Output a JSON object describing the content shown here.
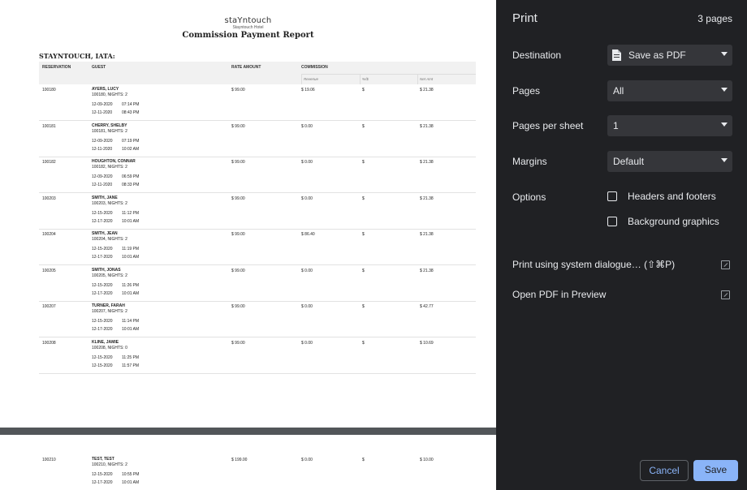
{
  "preview": {
    "logo": "staYntouch",
    "logo_sub": "Stayntouch Hotel",
    "report_title": "Commission Payment Report",
    "hotel_label": "STAYNTOUCH, IATA:",
    "columns": {
      "reservation": "RESERVATION",
      "guest": "GUEST",
      "rate": "RATE AMOUNT",
      "commission": "COMMISSION"
    },
    "subcolumns": {
      "revenue": "Revenue",
      "pct": "%/$",
      "net": "Net Amt"
    },
    "rows": [
      {
        "res": "100180",
        "guest": "AYERS, LUCY",
        "sub": "100180, NIGHTS: 2",
        "d1": "12-09-2020",
        "t1": "07:14 PM",
        "d2": "12-11-2020",
        "t2": "08:43 PM",
        "rate": "$ 99.00",
        "rev": "$ 19.06",
        "pct": "$",
        "net": "$ 21.38"
      },
      {
        "res": "100181",
        "guest": "CHERRY, SHELBY",
        "sub": "100181, NIGHTS: 2",
        "d1": "12-09-2020",
        "t1": "07:19 PM",
        "d2": "12-11-2020",
        "t2": "10:02 AM",
        "rate": "$ 99.00",
        "rev": "$ 0.00",
        "pct": "$",
        "net": "$ 21.38"
      },
      {
        "res": "100182",
        "guest": "HOUGHTON, CONNAR",
        "sub": "100182, NIGHTS: 2",
        "d1": "12-09-2020",
        "t1": "06:59 PM",
        "d2": "12-11-2020",
        "t2": "08:33 PM",
        "rate": "$ 99.00",
        "rev": "$ 0.00",
        "pct": "$",
        "net": "$ 21.38"
      },
      {
        "res": "100203",
        "guest": "SMITH, JANE",
        "sub": "100203, NIGHTS: 2",
        "d1": "12-15-2020",
        "t1": "11:12 PM",
        "d2": "12-17-2020",
        "t2": "10:01 AM",
        "rate": "$ 99.00",
        "rev": "$ 0.00",
        "pct": "$",
        "net": "$ 21.38"
      },
      {
        "res": "100204",
        "guest": "SMITH, JEAN",
        "sub": "100204, NIGHTS: 2",
        "d1": "12-15-2020",
        "t1": "11:19 PM",
        "d2": "12-17-2020",
        "t2": "10:01 AM",
        "rate": "$ 99.00",
        "rev": "$ 86.40",
        "pct": "$",
        "net": "$ 21.38"
      },
      {
        "res": "100205",
        "guest": "SMITH, JONAS",
        "sub": "100205, NIGHTS: 2",
        "d1": "12-15-2020",
        "t1": "11:26 PM",
        "d2": "12-17-2020",
        "t2": "10:01 AM",
        "rate": "$ 99.00",
        "rev": "$ 0.00",
        "pct": "$",
        "net": "$ 21.38"
      },
      {
        "res": "100207",
        "guest": "TURNER, FARAH",
        "sub": "100207, NIGHTS: 2",
        "d1": "12-15-2020",
        "t1": "11:14 PM",
        "d2": "12-17-2020",
        "t2": "10:01 AM",
        "rate": "$ 99.00",
        "rev": "$ 0.00",
        "pct": "$",
        "net": "$ 42.77"
      },
      {
        "res": "100208",
        "guest": "KLINE, JAMIE",
        "sub": "100208, NIGHTS: 0",
        "d1": "12-15-2020",
        "t1": "11:25 PM",
        "d2": "12-15-2020",
        "t2": "11:57 PM",
        "rate": "$ 99.00",
        "rev": "$ 0.00",
        "pct": "$",
        "net": "$ 10.69"
      }
    ],
    "page2_rows": [
      {
        "res": "100210",
        "guest": "TEST, TEST",
        "sub": "100210, NIGHTS: 2",
        "d1": "12-15-2020",
        "t1": "10:55 PM",
        "d2": "12-17-2020",
        "t2": "10:01 AM",
        "rate": "$ 199.00",
        "rev": "$ 0.00",
        "pct": "$",
        "net": "$ 10.00"
      }
    ]
  },
  "panel": {
    "title": "Print",
    "page_count": "3 pages",
    "destination": {
      "label": "Destination",
      "value": "Save as PDF",
      "icon": "pdf-file-icon"
    },
    "pages": {
      "label": "Pages",
      "value": "All"
    },
    "pages_per_sheet": {
      "label": "Pages per sheet",
      "value": "1"
    },
    "margins": {
      "label": "Margins",
      "value": "Default"
    },
    "options": {
      "label": "Options",
      "headers_footers": "Headers and footers",
      "background_graphics": "Background graphics"
    },
    "system_dialog": "Print using system dialogue… (⇧⌘P)",
    "open_preview": "Open PDF in Preview",
    "cancel": "Cancel",
    "save": "Save"
  },
  "colors": {
    "accent": "#8ab4f8",
    "panel_bg": "#202124",
    "select_bg": "#35363a",
    "preview_bg": "#525659"
  }
}
